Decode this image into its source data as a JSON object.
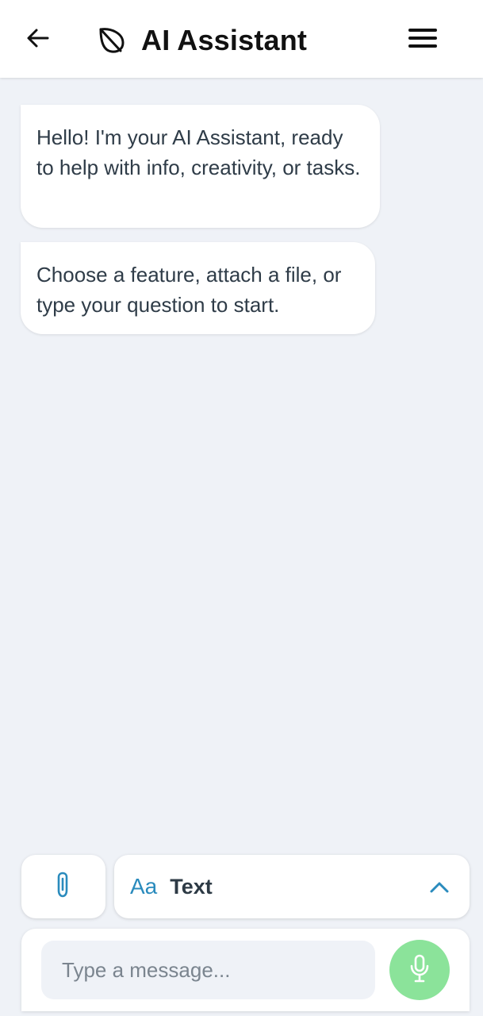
{
  "header": {
    "title": "AI Assistant",
    "back_icon": "arrow-left-icon",
    "title_icon": "leaf-icon",
    "menu_icon": "hamburger-menu-icon"
  },
  "messages": [
    {
      "text": "Hello! I'm your AI Assistant, ready to help with info, creativity, or tasks."
    },
    {
      "text": "Choose a feature, attach a file, or type your question to start."
    }
  ],
  "toolbar": {
    "attach_icon": "paperclip-icon",
    "mode_icon_text": "Aa",
    "mode_label": "Text",
    "mode_chevron_icon": "chevron-up-icon"
  },
  "composer": {
    "placeholder": "Type a message...",
    "value": "",
    "mic_icon": "microphone-icon"
  },
  "colors": {
    "background": "#eff2f7",
    "accent_blue": "#2a8bbd",
    "mic_green": "#8be39a"
  }
}
